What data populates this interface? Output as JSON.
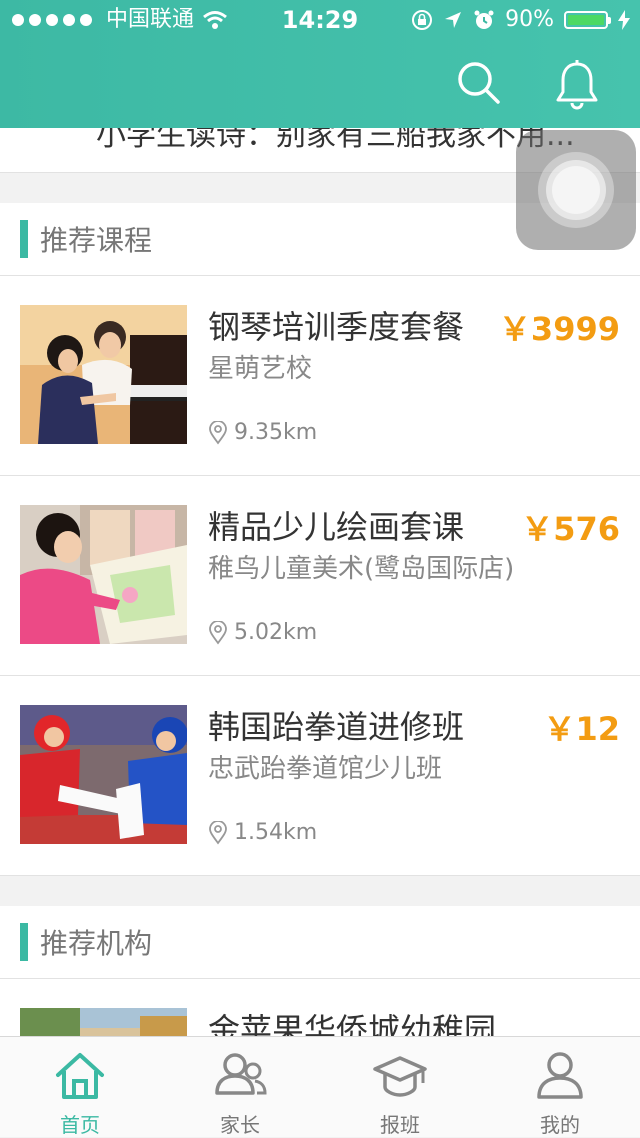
{
  "status_bar": {
    "carrier": "中国联通",
    "time": "14:29",
    "battery": "90%",
    "battery_level": 0.9
  },
  "header": {
    "search_icon": "search-icon",
    "bell_icon": "bell-icon"
  },
  "previous_item": {
    "text": "小学生读诗：别家有三船我家不用..."
  },
  "recommended_courses": {
    "title": "推荐课程",
    "items": [
      {
        "name": "钢琴培训季度套餐",
        "school": "星萌艺校",
        "price": "￥3999",
        "distance": "9.35km",
        "image": "piano-lesson-photo"
      },
      {
        "name": "精品少儿绘画套课",
        "school": "稚鸟儿童美术(鹭岛国际店)",
        "price": "￥576",
        "distance": "5.02km",
        "image": "child-painting-photo"
      },
      {
        "name": "韩国跆拳道进修班",
        "school": "忠武跆拳道馆少儿班",
        "price": "￥12",
        "distance": "1.54km",
        "image": "taekwondo-photo"
      }
    ]
  },
  "recommended_orgs": {
    "title": "推荐机构",
    "items": [
      {
        "name": "金苹果华侨城幼稚园",
        "image": "kindergarten-building-photo"
      }
    ]
  },
  "tabbar": {
    "tabs": [
      {
        "label": "首页",
        "icon": "home-icon",
        "active": true
      },
      {
        "label": "家长",
        "icon": "parents-icon",
        "active": false
      },
      {
        "label": "报班",
        "icon": "graduation-cap-icon",
        "active": false
      },
      {
        "label": "我的",
        "icon": "user-icon",
        "active": false
      }
    ]
  },
  "colors": {
    "brand": "#3bb9a3",
    "price": "#f39c12",
    "battery": "#4cd964"
  }
}
